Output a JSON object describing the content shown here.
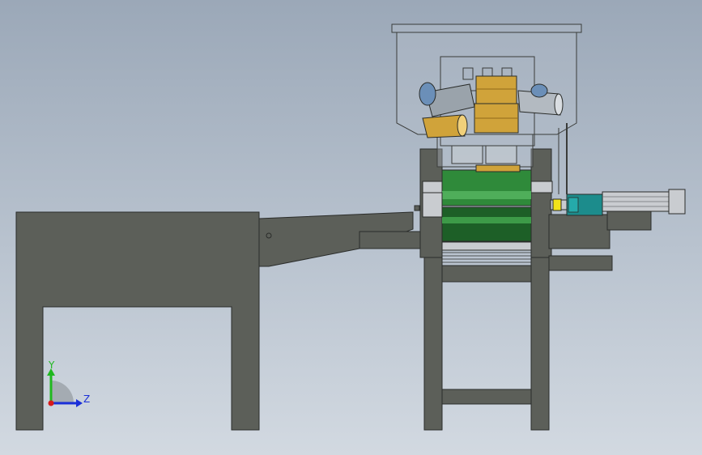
{
  "viewport": {
    "background_top": "#9ba8b8",
    "background_bottom": "#d2d9e1"
  },
  "colors": {
    "frame": "#5c5f59",
    "frame_dark": "#4b4e49",
    "outline": "#2a2c2a",
    "green_roller": "#2f8a3a",
    "green_dark": "#1d5f27",
    "gold": "#d0a33a",
    "gold_dark": "#8f6a1a",
    "teal_motor": "#1c8c8c",
    "yellow_coupling": "#f2e21a",
    "steel": "#c9ccd0",
    "glass": "#b7c1cc"
  },
  "triad": {
    "y_label": "Y",
    "z_label": "Z",
    "y_color": "#1fb81f",
    "z_color": "#1a2fd8",
    "origin_color": "#d81a1a"
  },
  "parts": {
    "left_table": "left-support-table",
    "chute": "feed-chute",
    "hopper": "feed-hopper",
    "roller_frame": "roller-frame",
    "motor": "drive-motor"
  }
}
